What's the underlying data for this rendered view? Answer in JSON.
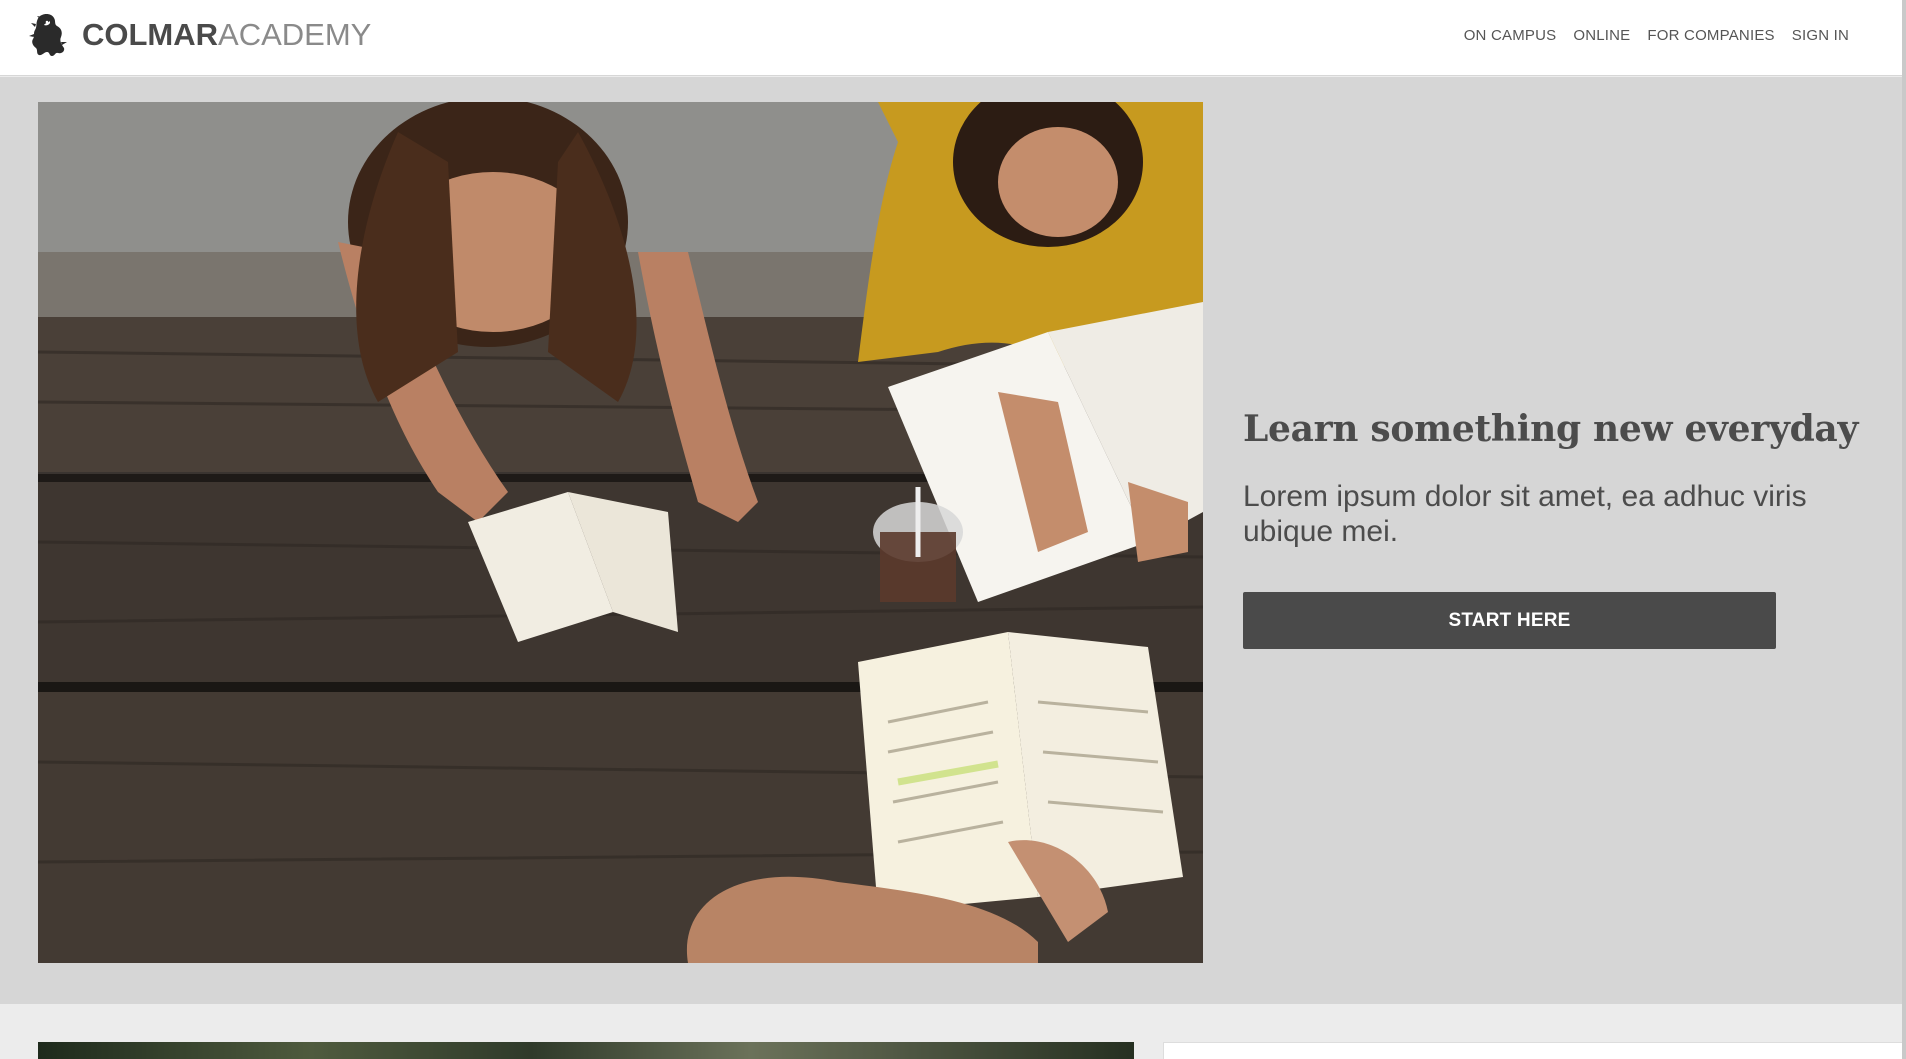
{
  "brand": {
    "name_bold": "COLMAR",
    "name_light": "ACADEMY",
    "logo_icon": "lion-crest-icon"
  },
  "nav": {
    "items": [
      {
        "label": "ON CAMPUS"
      },
      {
        "label": "ONLINE"
      },
      {
        "label": "FOR COMPANIES"
      },
      {
        "label": "SIGN IN"
      }
    ]
  },
  "hero": {
    "image": "students-studying-at-picnic-table-photo",
    "title": "Learn something new everyday",
    "subtitle": "Lorem ipsum dolor sit amet, ea adhuc viris ubique mei.",
    "cta_label": "START HERE"
  },
  "colors": {
    "header_bg": "#ffffff",
    "hero_bg": "#d6d6d6",
    "button_bg": "#4a4a4a",
    "text": "#4c4c4c"
  }
}
